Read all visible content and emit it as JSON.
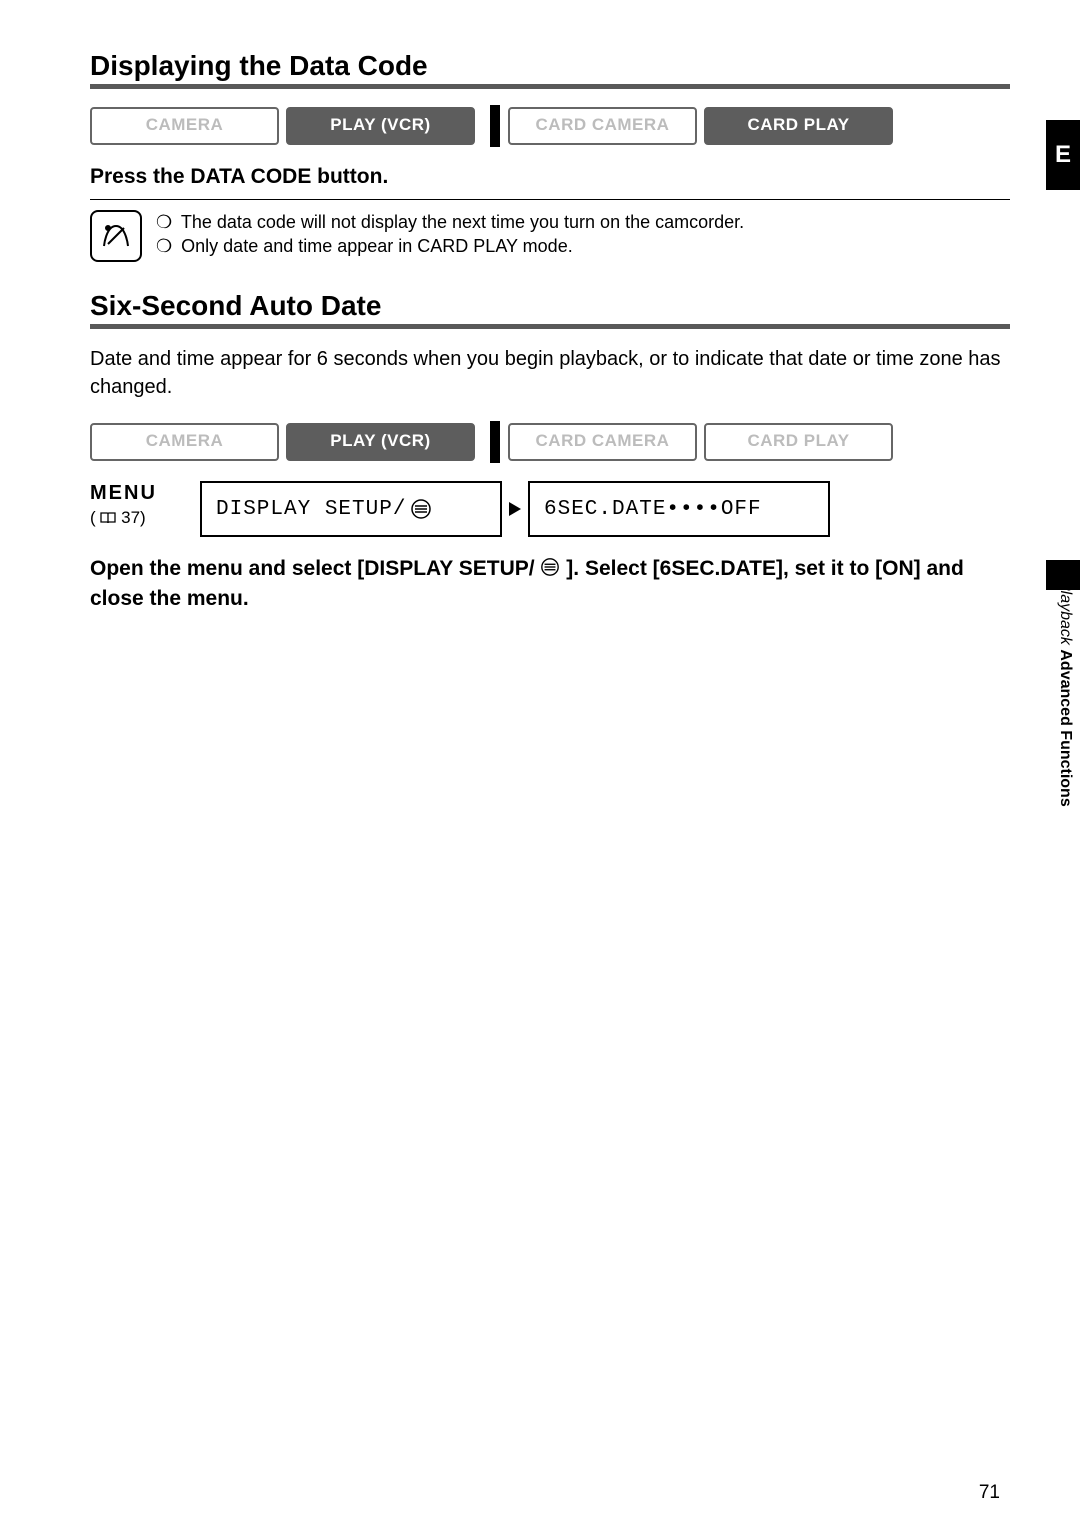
{
  "section1": {
    "heading": "Displaying the Data Code",
    "modes": {
      "camera": "CAMERA",
      "play_vcr": "PLAY (VCR)",
      "card_camera": "CARD CAMERA",
      "card_play": "CARD PLAY"
    },
    "instruction": "Press the DATA CODE button.",
    "notes": [
      "The data code will not display the next time you turn on the camcorder.",
      "Only date and time appear in CARD PLAY mode."
    ]
  },
  "section2": {
    "heading": "Six-Second Auto Date",
    "desc": "Date and time appear for 6 seconds when you begin playback, or to indicate that date or time zone has changed.",
    "modes": {
      "camera": "CAMERA",
      "play_vcr": "PLAY (VCR)",
      "card_camera": "CARD CAMERA",
      "card_play": "CARD PLAY"
    },
    "menu_label": "MENU",
    "menu_ref": "37",
    "menu_item1": "DISPLAY SETUP/",
    "menu_item2": "6SEC.DATE••••OFF",
    "instruction_a": "Open the menu and select [DISPLAY SETUP/",
    "instruction_b": "]. Select [6SEC.DATE], set it to [ON] and close the menu."
  },
  "side": {
    "tab": "E",
    "label_bold": "Advanced Functions",
    "label_italic": "Playback"
  },
  "page_number": "71"
}
